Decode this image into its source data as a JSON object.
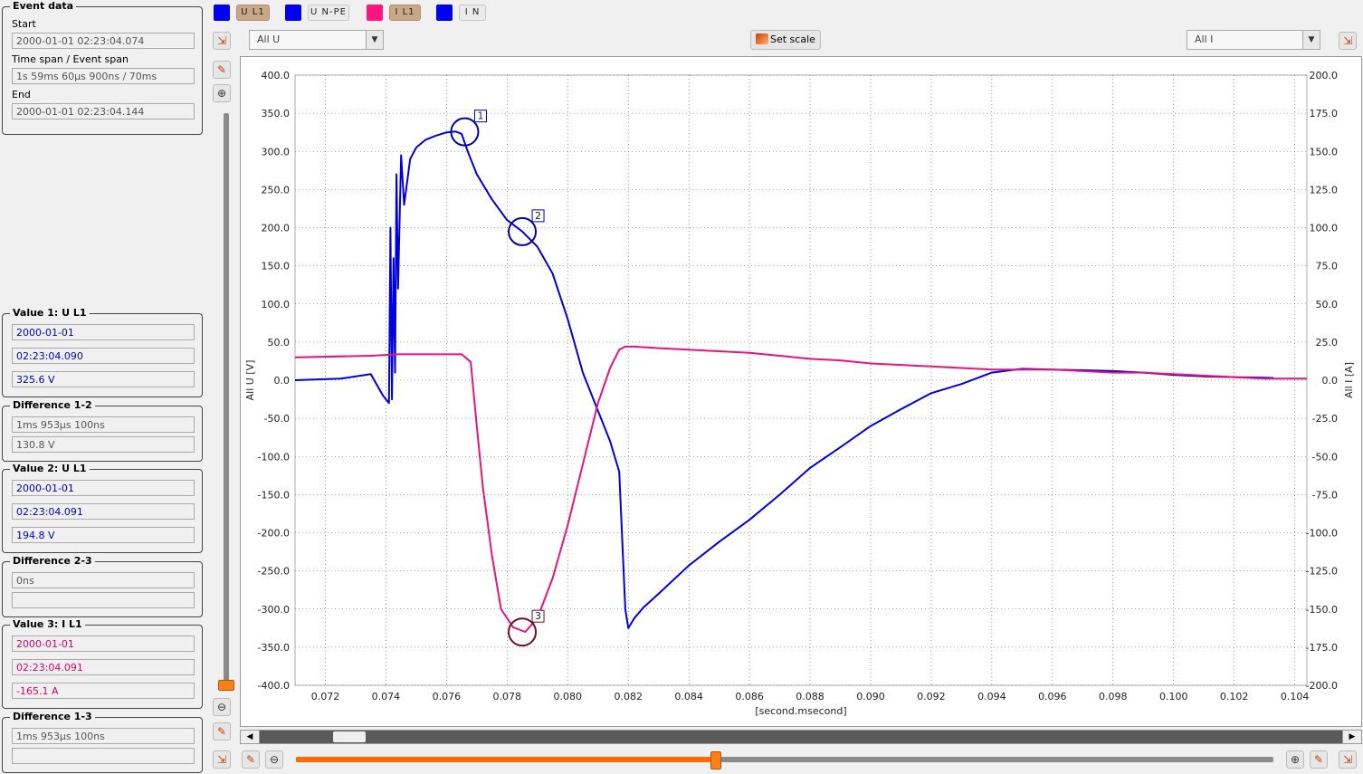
{
  "event_data": {
    "title": "Event data",
    "start_label": "Start",
    "start_value": "2000-01-01 02:23:04.074",
    "span_label": "Time span / Event span",
    "span_value": "1s 59ms 60µs 900ns / 70ms",
    "end_label": "End",
    "end_value": "2000-01-01 02:23:04.144"
  },
  "value1": {
    "title": "Value 1: U L1",
    "date": "2000-01-01",
    "time": "02:23:04.090",
    "value": "325.6 V"
  },
  "diff12": {
    "title": "Difference 1-2",
    "time": "1ms 953µs 100ns",
    "value": "130.8 V"
  },
  "value2": {
    "title": "Value 2: U L1",
    "date": "2000-01-01",
    "time": "02:23:04.091",
    "value": "194.8 V"
  },
  "diff23": {
    "title": "Difference 2-3",
    "time": "0ns",
    "value": ""
  },
  "value3": {
    "title": "Value 3: I L1",
    "date": "2000-01-01",
    "time": "02:23:04.091",
    "value": "-165.1 A"
  },
  "diff13": {
    "title": "Difference 1-3",
    "time": "1ms 953µs 100ns",
    "value": ""
  },
  "toolbar": {
    "channels": [
      {
        "label": "U L1",
        "color": "#0000ee",
        "active": true
      },
      {
        "label": "U N-PE",
        "color": "#0000ee",
        "active": false
      },
      {
        "label": "I L1",
        "color": "#ff1480",
        "active": true
      },
      {
        "label": "I N",
        "color": "#0000ee",
        "active": false
      }
    ],
    "left_combo": "All U",
    "right_combo": "All I",
    "set_scale": "Set scale"
  },
  "colors": {
    "voltage": "#0000dd",
    "current": "#e8137c"
  },
  "chart_data": {
    "type": "line",
    "xlabel": "[second.msecond]",
    "ylabel_left": "All U [V]",
    "ylabel_right": "All I [A]",
    "xlim": [
      0.071,
      0.1044
    ],
    "ylim_left": [
      -400,
      400
    ],
    "ylim_right": [
      -200,
      200
    ],
    "x_ticks": [
      "0.072",
      "0.074",
      "0.076",
      "0.078",
      "0.080",
      "0.082",
      "0.084",
      "0.086",
      "0.088",
      "0.090",
      "0.092",
      "0.094",
      "0.096",
      "0.098",
      "0.100",
      "0.102",
      "0.104"
    ],
    "y_left_ticks": [
      "400.0",
      "350.0",
      "300.0",
      "250.0",
      "200.0",
      "150.0",
      "100.0",
      "50.0",
      "0.0",
      "-50.0",
      "-100.0",
      "-150.0",
      "-200.0",
      "-250.0",
      "-300.0",
      "-350.0",
      "-400.0"
    ],
    "y_right_ticks": [
      "200.0",
      "175.0",
      "150.0",
      "125.0",
      "100.0",
      "75.0",
      "50.0",
      "25.0",
      "0.0",
      "-25.0",
      "-50.0",
      "-75.0",
      "-100.0",
      "-125.0",
      "-150.0",
      "-175.0",
      "-200.0"
    ],
    "grid": true,
    "series": [
      {
        "name": "U L1",
        "axis": "left",
        "x": [
          0.071,
          0.0725,
          0.0735,
          0.0739,
          0.0741,
          0.07415,
          0.0742,
          0.07425,
          0.0743,
          0.07435,
          0.0744,
          0.0745,
          0.0746,
          0.0748,
          0.075,
          0.0753,
          0.0756,
          0.076,
          0.0763,
          0.0765,
          0.0767,
          0.077,
          0.0775,
          0.078,
          0.0785,
          0.079,
          0.0795,
          0.08,
          0.0805,
          0.081,
          0.0814,
          0.0817,
          0.0819,
          0.082,
          0.0822,
          0.0825,
          0.083,
          0.084,
          0.085,
          0.086,
          0.087,
          0.088,
          0.089,
          0.09,
          0.091,
          0.092,
          0.093,
          0.094,
          0.095,
          0.096,
          0.097,
          0.098,
          0.099,
          0.1,
          0.101,
          0.102,
          0.1033
        ],
        "y": [
          0,
          2,
          8,
          -20,
          -30,
          200,
          -25,
          160,
          10,
          270,
          120,
          295,
          230,
          290,
          305,
          315,
          320,
          325,
          326,
          323,
          300,
          270,
          237,
          210,
          195,
          175,
          140,
          80,
          10,
          -40,
          -80,
          -120,
          -300,
          -325,
          -312,
          -298,
          -280,
          -243,
          -212,
          -183,
          -150,
          -115,
          -88,
          -60,
          -38,
          -17,
          -5,
          10,
          15,
          14,
          13,
          12,
          10,
          7,
          5,
          4,
          3
        ]
      },
      {
        "name": "I L1",
        "axis": "right",
        "x": [
          0.071,
          0.0735,
          0.0744,
          0.0765,
          0.0768,
          0.077,
          0.0772,
          0.0775,
          0.0778,
          0.0782,
          0.0786,
          0.079,
          0.0795,
          0.08,
          0.0805,
          0.081,
          0.0814,
          0.0817,
          0.0819,
          0.0822,
          0.083,
          0.084,
          0.085,
          0.086,
          0.087,
          0.088,
          0.089,
          0.09,
          0.091,
          0.092,
          0.093,
          0.094,
          0.095,
          0.096,
          0.097,
          0.098,
          0.099,
          0.1,
          0.101,
          0.102,
          0.103,
          0.1044
        ],
        "y": [
          15,
          16,
          17,
          17,
          12,
          -30,
          -70,
          -115,
          -150,
          -162,
          -165,
          -156,
          -130,
          -95,
          -55,
          -15,
          8,
          20,
          22,
          22,
          21,
          20,
          19,
          18,
          16,
          14,
          13,
          11,
          10,
          9,
          8,
          7,
          7,
          7,
          6,
          5,
          5,
          4,
          3,
          2,
          1,
          1
        ]
      }
    ],
    "markers": [
      {
        "label": "1",
        "axis": "left",
        "x": 0.0766,
        "y": 325.6,
        "color": "#0000aa"
      },
      {
        "label": "2",
        "axis": "left",
        "x": 0.0785,
        "y": 194.8,
        "color": "#0000aa"
      },
      {
        "label": "3",
        "axis": "right",
        "x": 0.0785,
        "y": -165.1,
        "color": "#6b1020"
      }
    ]
  }
}
